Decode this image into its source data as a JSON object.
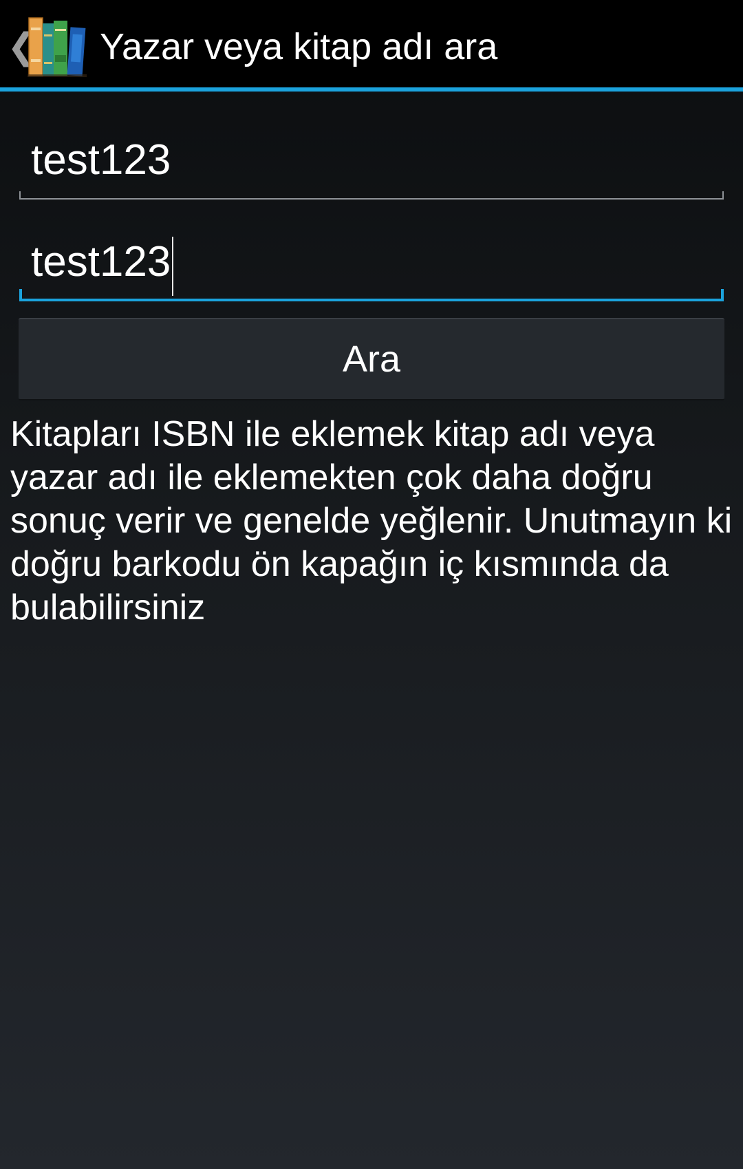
{
  "header": {
    "title": "Yazar veya kitap adı ara",
    "up_icon": "chevron-left-icon",
    "app_icon": "books-icon"
  },
  "form": {
    "author_field_value": "test123",
    "title_field_value": "test123",
    "search_button_label": "Ara"
  },
  "info": {
    "text": "Kitapları ISBN ile eklemek kitap adı veya yazar adı ile eklemekten çok daha doğru sonuç verir ve genelde yeğlenir. Unutmayın ki doğru barkodu ön kapağın iç kısmında da bulabilirsiniz"
  },
  "colors": {
    "accent": "#1ba3dd",
    "action_bar_bg": "#000000",
    "button_bg": "#25292e"
  }
}
